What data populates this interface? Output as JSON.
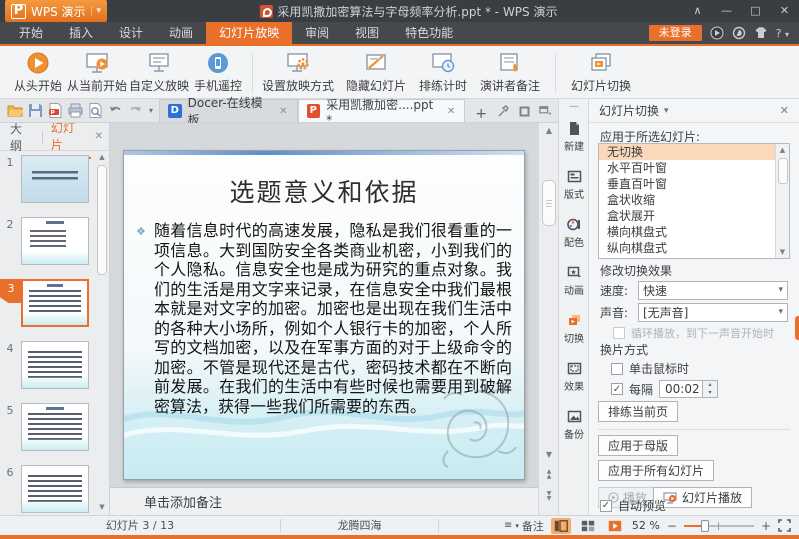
{
  "glyphs": {
    "caret": "▾",
    "caret_up": "▴",
    "close": "✕",
    "win_menu": "∧",
    "win_min": "—",
    "win_max": "□",
    "help": "?",
    "check": "✓",
    "tri_up": "▲",
    "tri_down": "▼",
    "plus": "+",
    "minus": "−",
    "hamburger": "≡",
    "hide_bar": "—"
  },
  "titlebar": {
    "app_logo": "P",
    "app_name": "WPS 演示",
    "doc_title": "采用凯撒加密算法与字母频率分析.ppt * - WPS 演示"
  },
  "menubar": {
    "tabs": [
      "开始",
      "插入",
      "设计",
      "动画",
      "幻灯片放映",
      "审阅",
      "视图",
      "特色功能"
    ],
    "active_tab": "幻灯片放映",
    "login": "未登录"
  },
  "ribbon": {
    "buttons": [
      "从头开始",
      "从当前开始",
      "自定义放映",
      "手机遥控",
      "设置放映方式",
      "隐藏幻灯片",
      "排练计时",
      "演讲者备注",
      "幻灯片切换"
    ]
  },
  "doc_tabs": {
    "tabs": [
      "Docer-在线模板",
      "采用凯撒加密....ppt *"
    ],
    "active": "采用凯撒加密....ppt *",
    "docer_logo": "D",
    "ppt_logo": "P"
  },
  "sidebar": {
    "tabs": [
      "大纲",
      "幻灯片"
    ],
    "active_tab": "幻灯片",
    "slide_numbers": [
      "1",
      "2",
      "3",
      "4",
      "5",
      "6"
    ],
    "selected_slide": "3"
  },
  "slide": {
    "title": "选题意义和依据",
    "bullet": "❖",
    "body": "随着信息时代的高速发展，隐私是我们很看重的一项信息。大到国防安全各类商业机密，小到我们的个人隐私。信息安全也是成为研究的重点对象。我们的生活是用文字来记录，在信息安全中我们最根本就是对文字的加密。加密也是出现在我们生活中的各种大小场所，例如个人银行卡的加密，个人所写的文档加密，以及在军事方面的对于上级命令的加密。不管是现代还是古代，密码技术都在不断向前发展。在我们的生活中有些时候也需要用到破解密算法，获得一些我们所需要的东西。"
  },
  "notes": {
    "placeholder": "单击添加备注"
  },
  "launcher": {
    "items": [
      "新建",
      "版式",
      "配色",
      "动画",
      "切换",
      "效果",
      "备份"
    ],
    "active": "切换"
  },
  "panel": {
    "title": "幻灯片切换",
    "apply_label": "应用于所选幻灯片:",
    "transitions": [
      "无切换",
      "水平百叶窗",
      "垂直百叶窗",
      "盒状收缩",
      "盒状展开",
      "横向棋盘式",
      "纵向棋盘式"
    ],
    "selected_transition": "无切换",
    "modify_label": "修改切换效果",
    "speed_label": "速度:",
    "speed_value": "快速",
    "sound_label": "声音:",
    "sound_value": "[无声音]",
    "loop_label": "循环播放，到下一声音开始时",
    "advance_label": "换片方式",
    "on_click_label": "单击鼠标时",
    "every_label": "每隔",
    "every_value": "00:02",
    "rehearse_button": "排练当前页",
    "apply_master_button": "应用于母版",
    "apply_all_button": "应用于所有幻灯片",
    "play_button": "播放",
    "slideshow_button": "幻灯片播放",
    "auto_preview_label": "自动预览"
  },
  "statusbar": {
    "counter": "幻灯片 3 / 13",
    "theme": "龙腾四海",
    "notes_label": "备注",
    "zoom": "52 %"
  },
  "colors": {
    "accent": "#e8702a",
    "selected_item_bg": "#fad9ba",
    "titlebar_bg": "#3a3d41"
  }
}
